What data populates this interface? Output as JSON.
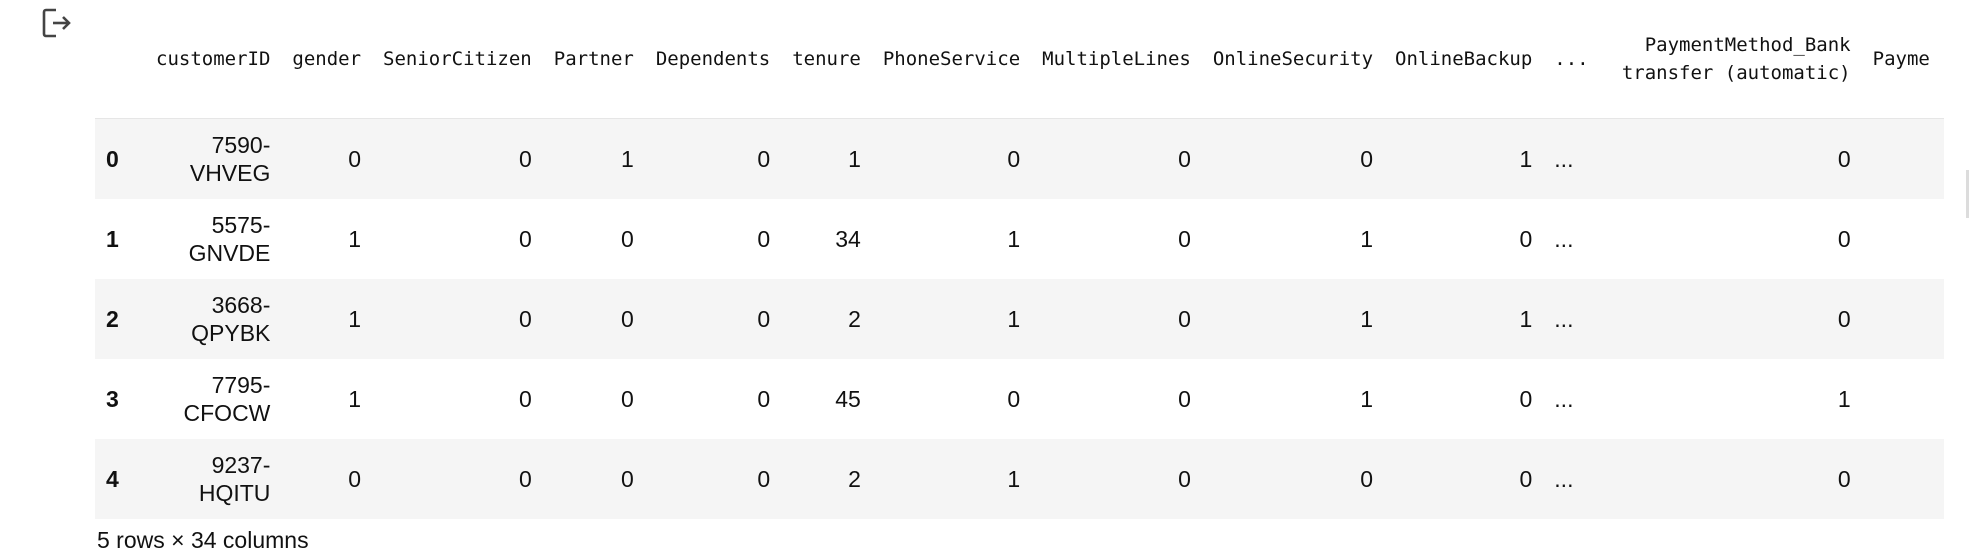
{
  "output": {
    "icon": "output-exit-icon"
  },
  "table": {
    "index_header": "",
    "columns": [
      "customerID",
      "gender",
      "SeniorCitizen",
      "Partner",
      "Dependents",
      "tenure",
      "PhoneService",
      "MultipleLines",
      "OnlineSecurity",
      "OnlineBackup",
      "...",
      "PaymentMethod_Bank transfer (automatic)",
      "Payme"
    ],
    "rows": [
      {
        "index": "0",
        "cells": [
          "7590-VHVEG",
          "0",
          "0",
          "1",
          "0",
          "1",
          "0",
          "0",
          "0",
          "1",
          "...",
          "0",
          ""
        ]
      },
      {
        "index": "1",
        "cells": [
          "5575-GNVDE",
          "1",
          "0",
          "0",
          "0",
          "34",
          "1",
          "0",
          "1",
          "0",
          "...",
          "0",
          ""
        ]
      },
      {
        "index": "2",
        "cells": [
          "3668-QPYBK",
          "1",
          "0",
          "0",
          "0",
          "2",
          "1",
          "0",
          "1",
          "1",
          "...",
          "0",
          ""
        ]
      },
      {
        "index": "3",
        "cells": [
          "7795-CFOCW",
          "1",
          "0",
          "0",
          "0",
          "45",
          "0",
          "0",
          "1",
          "0",
          "...",
          "1",
          ""
        ]
      },
      {
        "index": "4",
        "cells": [
          "9237-HQITU",
          "0",
          "0",
          "0",
          "0",
          "2",
          "1",
          "0",
          "0",
          "0",
          "...",
          "0",
          ""
        ]
      }
    ]
  },
  "summary": "5 rows × 34 columns"
}
